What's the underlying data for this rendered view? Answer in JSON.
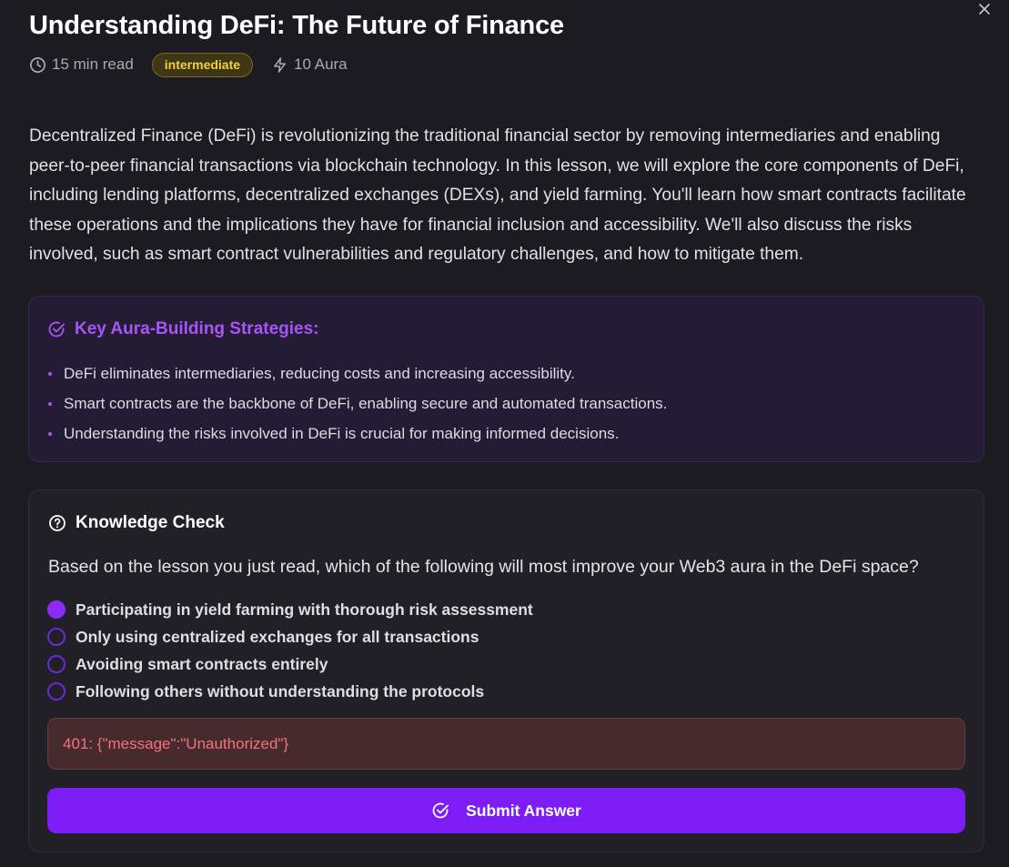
{
  "lesson": {
    "title": "Understanding DeFi: The Future of Finance",
    "read_time": "15 min read",
    "level": "intermediate",
    "reward": "10 Aura",
    "intro": "Decentralized Finance (DeFi) is revolutionizing the traditional financial sector by removing intermediaries and enabling peer-to-peer financial transactions via blockchain technology. In this lesson, we will explore the core components of DeFi, including lending platforms, decentralized exchanges (DEXs), and yield farming. You'll learn how smart contracts facilitate these operations and the implications they have for financial inclusion and accessibility. We'll also discuss the risks involved, such as smart contract vulnerabilities and regulatory challenges, and how to mitigate them."
  },
  "strategies": {
    "heading": "Key Aura-Building Strategies:",
    "items": [
      "DeFi eliminates intermediaries, reducing costs and increasing accessibility.",
      "Smart contracts are the backbone of DeFi, enabling secure and automated transactions.",
      "Understanding the risks involved in DeFi is crucial for making informed decisions."
    ]
  },
  "quiz": {
    "heading": "Knowledge Check",
    "question": "Based on the lesson you just read, which of the following will most improve your Web3 aura in the DeFi space?",
    "options": [
      "Participating in yield farming with thorough risk assessment",
      "Only using centralized exchanges for all transactions",
      "Avoiding smart contracts entirely",
      "Following others without understanding the protocols"
    ],
    "selected_index": 0,
    "error": "401: {\"message\":\"Unauthorized\"}",
    "submit_label": "Submit Answer"
  },
  "icons": {
    "close": "close-icon",
    "read_time": "clock-icon",
    "reward": "lightning-icon",
    "strategies": "check-circle-icon",
    "quiz": "question-circle-icon",
    "submit": "check-circle-icon"
  },
  "colors": {
    "background": "#1b1b21",
    "accent": "#7e1cf8",
    "strategy_heading": "#a855f7",
    "badge_text": "#f4cf3a",
    "error_text": "#f2737a"
  }
}
